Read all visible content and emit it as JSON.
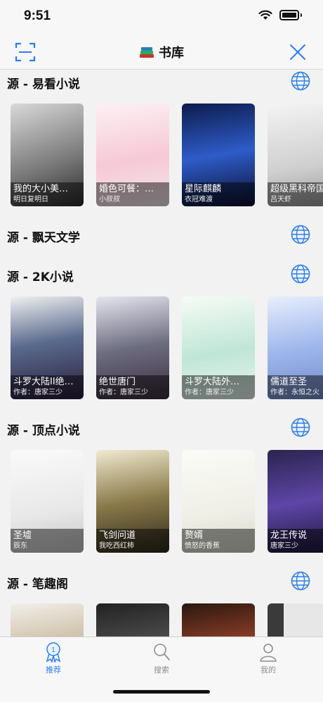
{
  "status": {
    "time": "9:51"
  },
  "nav": {
    "title": "书库"
  },
  "sections": [
    {
      "title": "源 - 易看小说",
      "books": [
        {
          "title": "我的大小美…",
          "author": "明日复明日"
        },
        {
          "title": "婚色可餐：…",
          "author": "小叔叔"
        },
        {
          "title": "星际麒麟",
          "author": "衣冠难渡"
        },
        {
          "title": "超级黑科帝国",
          "author": "吕天虾"
        }
      ]
    },
    {
      "title": "源 - 飘天文学",
      "books": []
    },
    {
      "title": "源 - 2K小说",
      "books": [
        {
          "title": "斗罗大陆II绝…",
          "author": "作者：唐家三少"
        },
        {
          "title": "绝世唐门",
          "author": "作者：唐家三少"
        },
        {
          "title": "斗罗大陆外…",
          "author": "作者：唐家三少"
        },
        {
          "title": "儒道至圣",
          "author": "作者：永恒之火"
        }
      ]
    },
    {
      "title": "源 - 顶点小说",
      "books": [
        {
          "title": "圣墟",
          "author": "辰东"
        },
        {
          "title": "飞剑问道",
          "author": "我吃西红柿"
        },
        {
          "title": "赘婿",
          "author": "愤怒的香蕉"
        },
        {
          "title": "龙王传说",
          "author": "唐家三少"
        }
      ]
    },
    {
      "title": "源 - 笔趣阁",
      "books": [
        {
          "title": "",
          "author": ""
        },
        {
          "title": "",
          "author": ""
        },
        {
          "title": "",
          "author": ""
        },
        {
          "title": "",
          "author": ""
        }
      ]
    }
  ],
  "tabs": [
    {
      "label": "推荐",
      "icon": "badge-icon",
      "active": true
    },
    {
      "label": "搜索",
      "icon": "search-icon",
      "active": false
    },
    {
      "label": "我的",
      "icon": "person-icon",
      "active": false
    }
  ],
  "colors": {
    "accent": "#2a7ef2"
  }
}
